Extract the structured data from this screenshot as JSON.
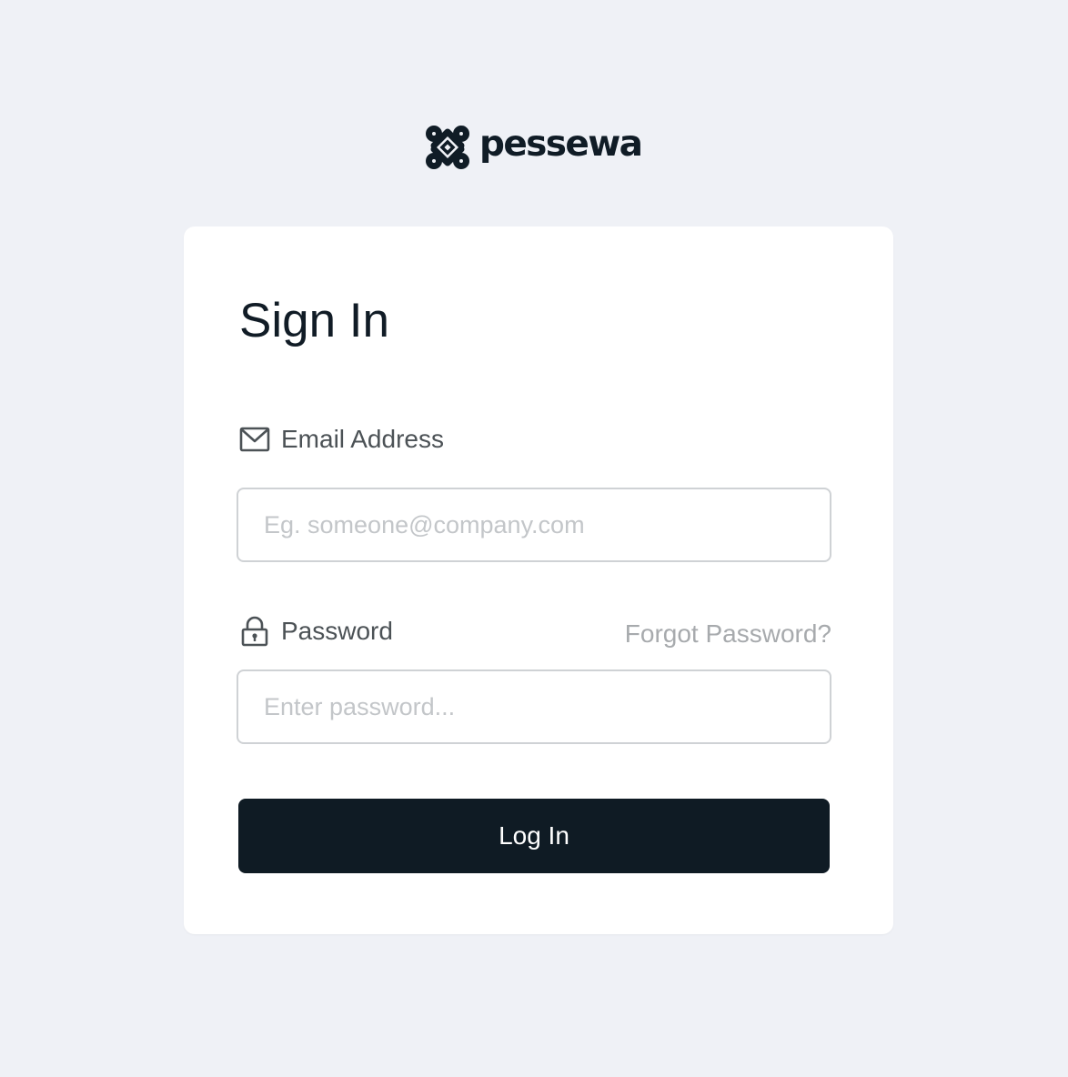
{
  "brand": {
    "name": "pessewa",
    "logo_icon": "pessewa-logo-mark",
    "color": "#101c26"
  },
  "form": {
    "title": "Sign In",
    "email": {
      "icon": "mail-icon",
      "label": "Email Address",
      "value": "",
      "placeholder": "Eg. someone@company.com"
    },
    "password": {
      "icon": "lock-icon",
      "label": "Password",
      "value": "",
      "placeholder": "Enter password...",
      "forgot_label": "Forgot Password?"
    },
    "submit_label": "Log In"
  },
  "colors": {
    "page_background": "#eff1f6",
    "card_background": "#ffffff",
    "button_background": "#0f1b24",
    "button_text": "#ffffff",
    "muted_text": "#a7aaad"
  }
}
